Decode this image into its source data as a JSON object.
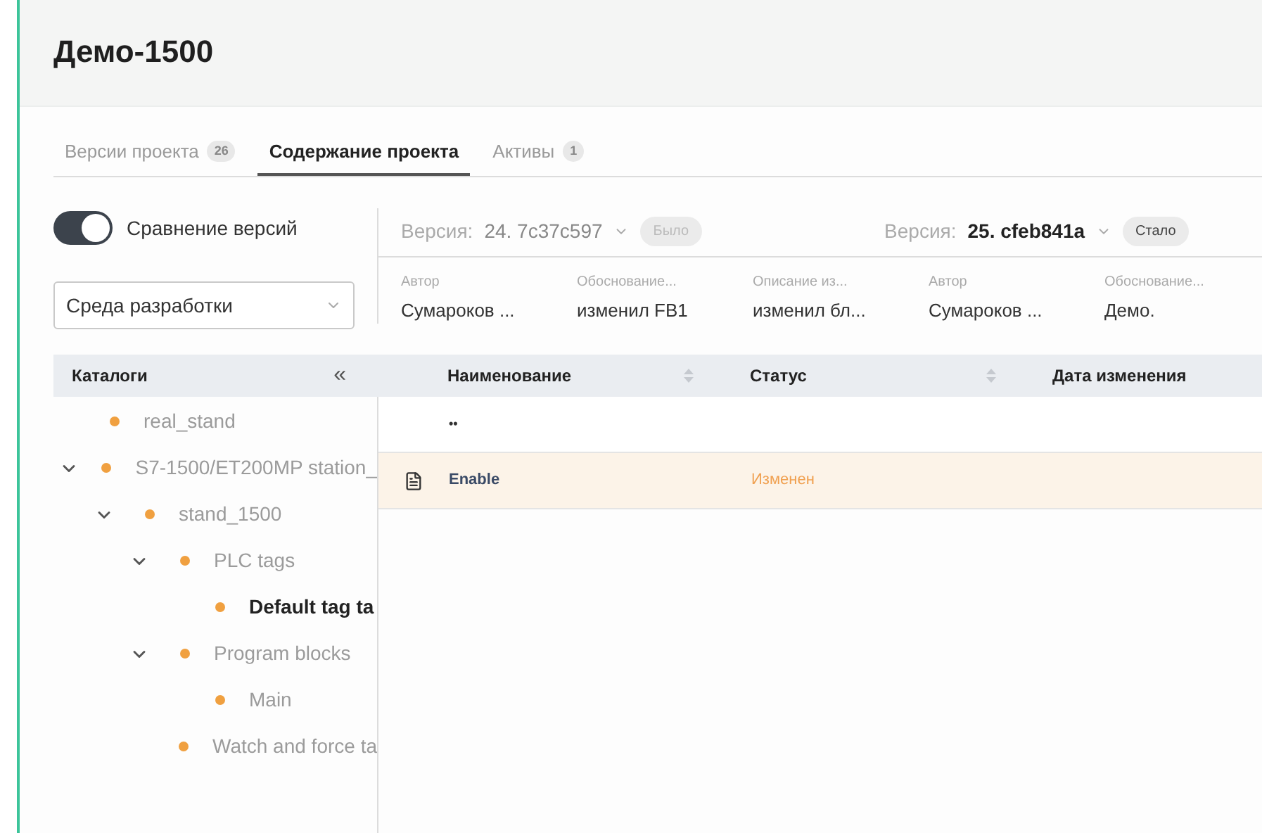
{
  "title": "Демо-1500",
  "tabs": [
    {
      "label": "Версии проекта",
      "count": "26",
      "selected": false
    },
    {
      "label": "Содержание проекта",
      "selected": true
    },
    {
      "label": "Активы",
      "count": "1",
      "selected": false
    }
  ],
  "compare_toggle": {
    "label": "Сравнение версий",
    "on": true
  },
  "environment_select": {
    "value": "Среда разработки"
  },
  "versions": [
    {
      "kind": "before",
      "label": "Версия:",
      "value": "24. 7c37c597",
      "badge": "Было"
    },
    {
      "kind": "after",
      "label": "Версия:",
      "value": "25. cfeb841a",
      "badge": "Стало"
    }
  ],
  "metadata": [
    {
      "label": "Автор",
      "value": "Сумароков ..."
    },
    {
      "label": "Обоснование...",
      "value": "изменил FB1"
    },
    {
      "label": "Описание из...",
      "value": "изменил бл..."
    },
    {
      "label": "Автор",
      "value": "Сумароков ..."
    },
    {
      "label": "Обоснование...",
      "value": "Демо."
    }
  ],
  "catalog": {
    "title": "Каталоги",
    "collapse_glyph": "«"
  },
  "tree": [
    {
      "label": "real_stand",
      "selected": false
    },
    {
      "label": "S7-1500/ET200MP station_",
      "selected": false,
      "expanded": true,
      "children": [
        {
          "label": "stand_1500",
          "selected": false,
          "expanded": true,
          "children": [
            {
              "label": "PLC tags",
              "selected": false,
              "expanded": true,
              "children": [
                {
                  "label": "Default tag ta",
                  "selected": true
                }
              ]
            },
            {
              "label": "Program blocks",
              "selected": false,
              "expanded": true,
              "children": [
                {
                  "label": "Main",
                  "selected": false
                }
              ]
            },
            {
              "label": "Watch and force ta",
              "selected": false
            }
          ]
        }
      ]
    }
  ],
  "table": {
    "columns": [
      "Наименование",
      "Статус",
      "Дата изменения"
    ],
    "rows": [
      {
        "kind": "parent",
        "name": "••",
        "highlighted": false
      },
      {
        "kind": "file",
        "name": "Enable",
        "status": "Изменен",
        "highlighted": true
      }
    ]
  }
}
